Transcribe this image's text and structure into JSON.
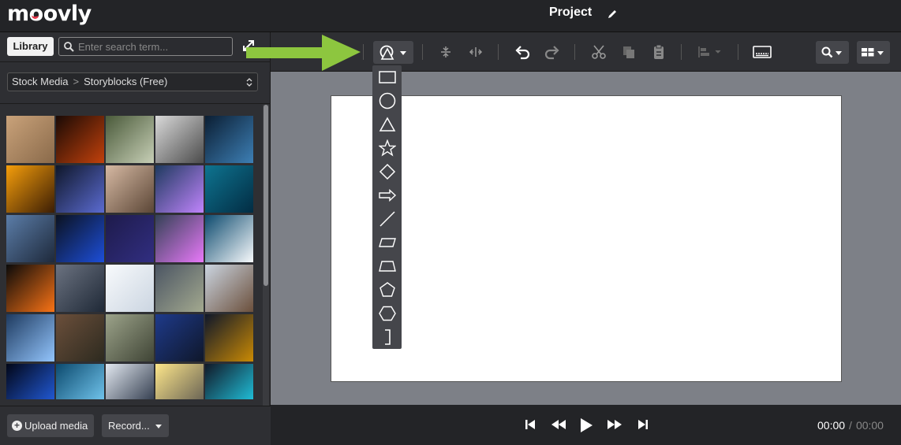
{
  "app": {
    "logo_text": "moovly",
    "project_title": "Project"
  },
  "library": {
    "tab_label": "Library",
    "search_placeholder": "Enter search term...",
    "breadcrumb": [
      "Stock Media",
      "Storyblocks (Free)"
    ]
  },
  "media_thumbnails": [
    "runner-feet",
    "sparks-fire",
    "money-cash",
    "laptop-typing",
    "silhouette-man",
    "sunset-clouds",
    "city-night",
    "woman-eyes-closed",
    "glasses-reflection",
    "underwater-light",
    "city-aerial",
    "code-screen",
    "starry-space",
    "glasses-reflection-2",
    "earth-from-space",
    "explosion-glow",
    "crowd-people",
    "screen-ui",
    "mountain-haze",
    "hands-phone",
    "ocean-water",
    "hands-sprout",
    "dollar-bills",
    "network-people",
    "world-lights",
    "earth-globe",
    "eye-closeup",
    "business-laptop",
    "hands-sunlight",
    "hologram-tablet"
  ],
  "bottom_left": {
    "upload_label": "Upload media",
    "record_label": "Record..."
  },
  "toolbar": {
    "tools": [
      "shape-tool",
      "distribute-vertical",
      "distribute-horizontal",
      "undo",
      "redo",
      "cut",
      "copy",
      "paste",
      "align",
      "subtitles",
      "zoom",
      "layout"
    ]
  },
  "shape_menu": {
    "items": [
      "rectangle",
      "circle",
      "triangle",
      "star",
      "diamond",
      "arrow",
      "line",
      "parallelogram",
      "trapezoid",
      "pentagon",
      "hexagon",
      "bracket"
    ]
  },
  "playback": {
    "current_time": "00:00",
    "separator": "/",
    "total_time": "00:00"
  },
  "colors": {
    "accent": "#8dc63f",
    "brand_red": "#e8364b",
    "panel": "#2e2f33",
    "canvas": "#ffffff"
  }
}
